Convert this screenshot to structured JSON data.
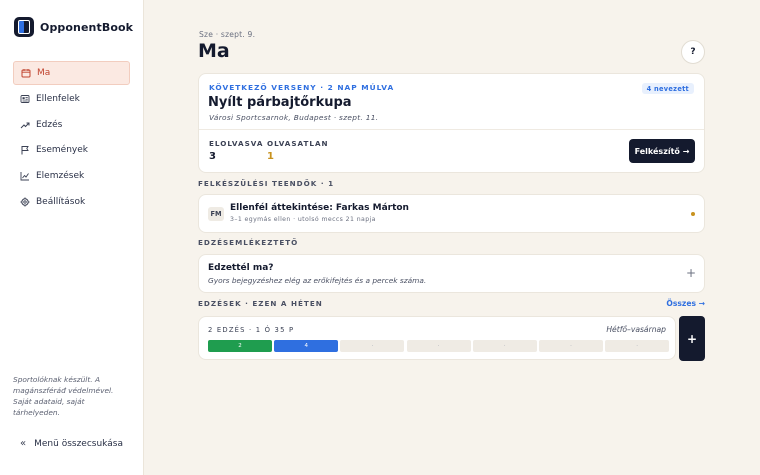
{
  "app": {
    "name": "OpponentBook"
  },
  "sidebar": {
    "items": [
      {
        "label": "Ma",
        "icon": "calendar-icon",
        "active": true
      },
      {
        "label": "Ellenfelek",
        "icon": "id-card-icon",
        "active": false
      },
      {
        "label": "Edzés",
        "icon": "trend-up-icon",
        "active": false
      },
      {
        "label": "Események",
        "icon": "flag-icon",
        "active": false
      },
      {
        "label": "Elemzések",
        "icon": "line-chart-icon",
        "active": false
      },
      {
        "label": "Beállítások",
        "icon": "gear-icon",
        "active": false
      }
    ],
    "note": "Sportolóknak készült. A magánszféráđ védelmével. Saját adataid, saját tárhelyeden.",
    "collapse_label": "Menü összecsukása"
  },
  "header": {
    "date": "Sze · szept. 9.",
    "title": "Ma",
    "help_label": "?"
  },
  "next_competition": {
    "kicker": "KÖVETKEZŐ VERSENY · 2 NAP MÚLVA",
    "badge": "4 nevezett",
    "name": "Nyílt párbajtőrkupa",
    "location": "Városi Sportcsarnok, Budapest · szept. 11.",
    "stats": [
      {
        "label": "ELOLVASVA",
        "value": "3",
        "color": "#141a2e"
      },
      {
        "label": "OLVASATLAN",
        "value": "1",
        "color": "#c8921f"
      }
    ],
    "button_label": "Felkészítő →"
  },
  "tasks": {
    "heading": "FELKÉSZÜLÉSI TEENDŐK · 1",
    "items": [
      {
        "initials": "FM",
        "title": "Ellenfél áttekintése: Farkas Márton",
        "subtitle": "3–1 egymás ellen · utolsó meccs 21 napja",
        "status_color": "#c8921f"
      }
    ]
  },
  "reminder": {
    "heading": "EDZÉSEMLÉKEZTETŐ",
    "title": "Edzettél ma?",
    "subtitle": "Gyors bejegyzéshez elég az erőkifejtés és a percek száma.",
    "add_label": "+"
  },
  "week": {
    "heading": "EDZÉSEK · EZEN A HÉTEN",
    "all_link": "Összes →",
    "summary": "2 EDZÉS · 1 Ó 35 P",
    "range": "Hétfő–vasárnap",
    "days": [
      {
        "label": "2",
        "color": "#1f9d4f",
        "text_color": "#ffffff"
      },
      {
        "label": "4",
        "color": "#2f6fe0",
        "text_color": "#ffffff"
      },
      {
        "label": "·",
        "color": "#efebe4",
        "text_color": "#9aa0ac"
      },
      {
        "label": "·",
        "color": "#efebe4",
        "text_color": "#9aa0ac"
      },
      {
        "label": "·",
        "color": "#efebe4",
        "text_color": "#9aa0ac"
      },
      {
        "label": "·",
        "color": "#efebe4",
        "text_color": "#9aa0ac"
      },
      {
        "label": "·",
        "color": "#efebe4",
        "text_color": "#9aa0ac"
      }
    ],
    "add_label": "+"
  },
  "colors": {
    "accent": "#2f6fe0",
    "active_nav": "#c0442f",
    "dark": "#141a2e",
    "warning": "#c8921f"
  }
}
